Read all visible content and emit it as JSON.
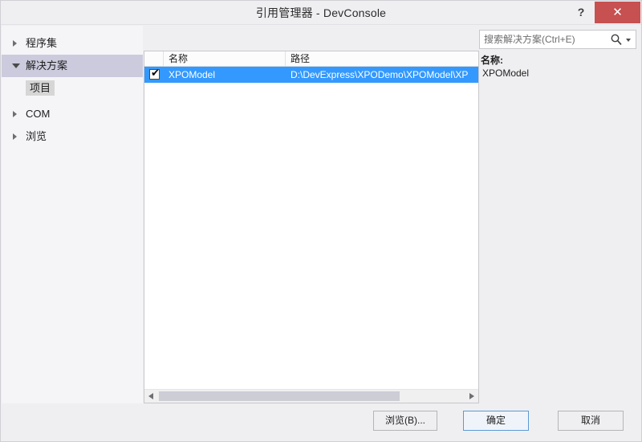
{
  "window": {
    "title": "引用管理器 - DevConsole",
    "help_label": "?",
    "close_label": "✕",
    "close_color": "#c75050"
  },
  "sidebar": {
    "items": [
      {
        "label": "程序集",
        "state": "collapsed",
        "selected": false
      },
      {
        "label": "解决方案",
        "state": "expanded",
        "selected": true
      },
      {
        "label": "项目",
        "state": "leaf",
        "selected": true
      },
      {
        "label": "COM",
        "state": "collapsed",
        "selected": false
      },
      {
        "label": "浏览",
        "state": "collapsed",
        "selected": false
      }
    ]
  },
  "search": {
    "placeholder": "搜索解决方案(Ctrl+E)",
    "value": "",
    "icon": "search-icon",
    "caret": "chevron-down-icon"
  },
  "list": {
    "columns": [
      {
        "key": "check",
        "label": ""
      },
      {
        "key": "name",
        "label": "名称"
      },
      {
        "key": "path",
        "label": "路径"
      }
    ],
    "rows": [
      {
        "checked": true,
        "check_glyph": "✔",
        "name": "XPOModel",
        "path": "D:\\DevExpress\\XPODemo\\XPOModel\\XP",
        "selected": true,
        "selection_color": "#3399ff"
      }
    ],
    "scrollbar": {
      "left_arrow": "◀",
      "right_arrow": "▶",
      "thumb_position_percent": 0,
      "thumb_width_percent": 75
    }
  },
  "detail": {
    "name_label": "名称:",
    "name_value": "XPOModel"
  },
  "footer": {
    "browse_label": "浏览(B)...",
    "ok_label": "确定",
    "cancel_label": "取消",
    "default_button": "确定"
  }
}
